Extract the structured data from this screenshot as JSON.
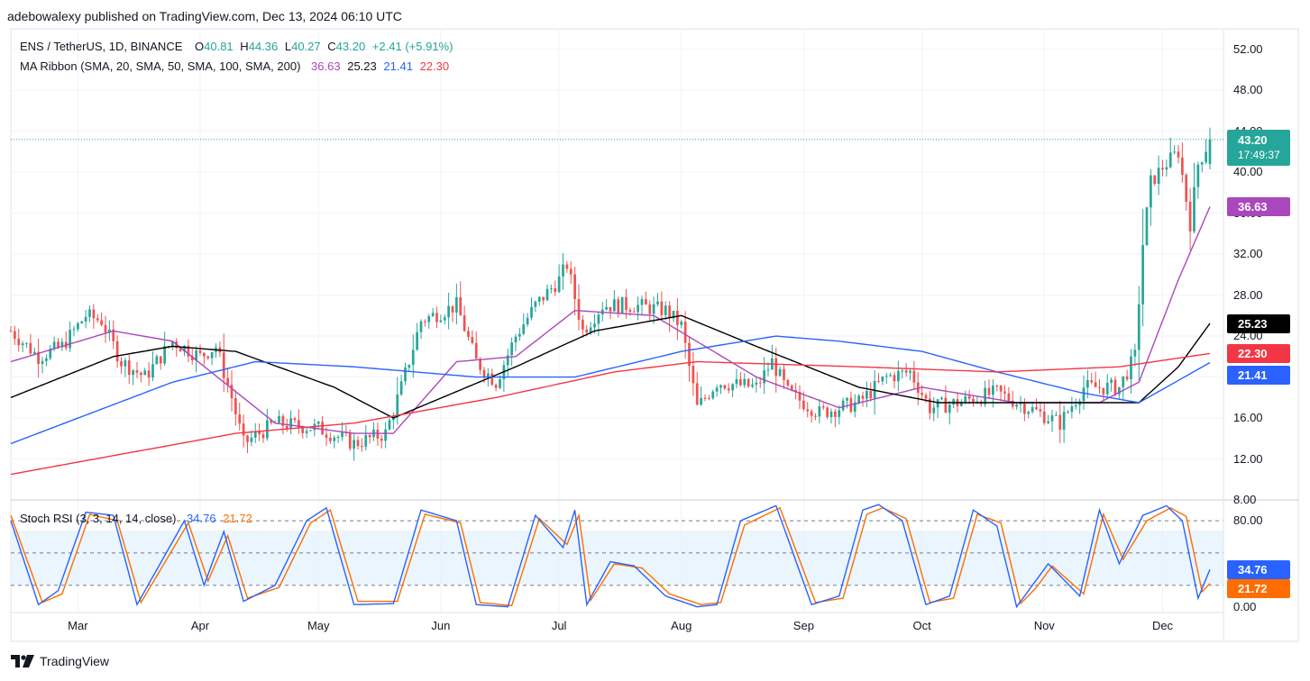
{
  "header": {
    "publish_line": "adebowalexy published on TradingView.com, Dec 13, 2024 06:10 UTC"
  },
  "footer": {
    "brand": "TradingView"
  },
  "legend": {
    "symbol": "ENS / TetherUS, 1D, BINANCE",
    "o_label": "O",
    "o_value": "40.81",
    "h_label": "H",
    "h_value": "44.36",
    "l_label": "L",
    "l_value": "40.27",
    "c_label": "C",
    "c_value": "43.20",
    "change": "+2.41 (+5.91%)",
    "ma_label": "MA Ribbon (SMA, 20, SMA, 50, SMA, 100, SMA, 200)",
    "ma_values": [
      "36.63",
      "25.23",
      "21.41",
      "22.30"
    ],
    "rsi_label": "Stoch RSI (3, 3, 14, 14, close)",
    "rsi_values": [
      "34.76",
      "21.72"
    ]
  },
  "price_tags": {
    "last": "43.20",
    "countdown": "17:49:37",
    "sma20": "36.63",
    "sma50": "25.23",
    "sma200": "22.30",
    "sma100": "21.41",
    "rsi_k": "34.76",
    "rsi_d": "21.72"
  },
  "colors": {
    "up": "#26a69a",
    "down": "#ef5350",
    "sma20": "#ab47bc",
    "sma50": "#000000",
    "sma100": "#2962ff",
    "sma200": "#f23645",
    "rsi_k": "#2962ff",
    "rsi_d": "#ff6d00",
    "rsi_band": "#e3f2fd"
  },
  "chart_data": [
    {
      "type": "candlestick",
      "title": "ENS / TetherUS, 1D, BINANCE",
      "y_ticks": [
        "52.00",
        "48.00",
        "44.00",
        "40.00",
        "36.00",
        "32.00",
        "28.00",
        "24.00",
        "20.00",
        "16.00",
        "12.00",
        "8.00"
      ],
      "x_ticks": [
        "Mar",
        "Apr",
        "May",
        "Jun",
        "Jul",
        "Aug",
        "Sep",
        "Oct",
        "Nov",
        "Dec"
      ],
      "ylim": [
        8,
        54
      ],
      "close_anchors": [
        [
          "Feb 13",
          24.5
        ],
        [
          "Feb 20",
          22.0
        ],
        [
          "Feb 26",
          23.0
        ],
        [
          "Mar 3",
          26.0
        ],
        [
          "Mar 7",
          25.5
        ],
        [
          "Mar 12",
          21.5
        ],
        [
          "Mar 18",
          20.0
        ],
        [
          "Mar 25",
          23.5
        ],
        [
          "Apr 1",
          22.0
        ],
        [
          "Apr 5",
          23.0
        ],
        [
          "Apr 9",
          18.0
        ],
        [
          "Apr 12",
          13.5
        ],
        [
          "Apr 20",
          15.5
        ],
        [
          "May 1",
          15.0
        ],
        [
          "May 10",
          13.5
        ],
        [
          "May 18",
          14.5
        ],
        [
          "May 22",
          19.0
        ],
        [
          "May 27",
          25.5
        ],
        [
          "Jun 5",
          27.0
        ],
        [
          "Jun 10",
          21.5
        ],
        [
          "Jun 15",
          19.5
        ],
        [
          "Jun 20",
          24.0
        ],
        [
          "Jun 25",
          27.0
        ],
        [
          "Jul 1",
          29.5
        ],
        [
          "Jul 3",
          31.0
        ],
        [
          "Jul 7",
          24.5
        ],
        [
          "Jul 12",
          27.0
        ],
        [
          "Jul 20",
          27.0
        ],
        [
          "Jul 28",
          26.5
        ],
        [
          "Aug 1",
          25.0
        ],
        [
          "Aug 5",
          17.0
        ],
        [
          "Aug 10",
          19.5
        ],
        [
          "Aug 20",
          19.0
        ],
        [
          "Aug 24",
          21.5
        ],
        [
          "Aug 28",
          18.5
        ],
        [
          "Sep 5",
          16.5
        ],
        [
          "Sep 15",
          17.5
        ],
        [
          "Sep 22",
          20.0
        ],
        [
          "Sep 28",
          20.5
        ],
        [
          "Oct 3",
          17.0
        ],
        [
          "Oct 10",
          17.5
        ],
        [
          "Oct 20",
          18.5
        ],
        [
          "Oct 28",
          17.0
        ],
        [
          "Nov 5",
          15.5
        ],
        [
          "Nov 11",
          19.0
        ],
        [
          "Nov 20",
          19.0
        ],
        [
          "Nov 24",
          22.0
        ],
        [
          "Nov 26",
          33.0
        ],
        [
          "Nov 28",
          39.0
        ],
        [
          "Dec 1",
          40.5
        ],
        [
          "Dec 5",
          42.0
        ],
        [
          "Dec 8",
          35.0
        ],
        [
          "Dec 10",
          40.8
        ],
        [
          "Dec 13",
          43.2
        ]
      ],
      "series": [
        {
          "name": "SMA 20",
          "last": 36.63,
          "anchors": [
            [
              "Feb 13",
              21.5
            ],
            [
              "Mar 10",
              24.5
            ],
            [
              "Mar 25",
              23.5
            ],
            [
              "Apr 20",
              15.5
            ],
            [
              "May 10",
              14.5
            ],
            [
              "May 20",
              14.5
            ],
            [
              "Jun 5",
              21.5
            ],
            [
              "Jun 20",
              22.0
            ],
            [
              "Jul 5",
              26.5
            ],
            [
              "Jul 25",
              26.0
            ],
            [
              "Aug 20",
              20.0
            ],
            [
              "Sep 10",
              17.0
            ],
            [
              "Oct 1",
              19.0
            ],
            [
              "Oct 25",
              17.5
            ],
            [
              "Nov 15",
              17.5
            ],
            [
              "Nov 25",
              19.5
            ],
            [
              "Dec 5",
              29.5
            ],
            [
              "Dec 13",
              36.63
            ]
          ]
        },
        {
          "name": "SMA 50",
          "last": 25.23,
          "anchors": [
            [
              "Feb 13",
              18.0
            ],
            [
              "Mar 10",
              22.0
            ],
            [
              "Mar 25",
              23.0
            ],
            [
              "Apr 10",
              22.5
            ],
            [
              "May 5",
              19.0
            ],
            [
              "May 20",
              16.0
            ],
            [
              "Jun 20",
              21.0
            ],
            [
              "Jul 10",
              24.5
            ],
            [
              "Aug 1",
              26.0
            ],
            [
              "Aug 20",
              23.0
            ],
            [
              "Sep 15",
              19.0
            ],
            [
              "Oct 5",
              17.5
            ],
            [
              "Nov 5",
              17.5
            ],
            [
              "Nov 25",
              17.5
            ],
            [
              "Dec 5",
              21.0
            ],
            [
              "Dec 13",
              25.23
            ]
          ]
        },
        {
          "name": "SMA 100",
          "last": 21.41,
          "anchors": [
            [
              "Feb 13",
              13.5
            ],
            [
              "Mar 25",
              19.5
            ],
            [
              "Apr 15",
              21.5
            ],
            [
              "May 10",
              21.0
            ],
            [
              "Jun 10",
              20.0
            ],
            [
              "Jul 5",
              20.0
            ],
            [
              "Aug 1",
              22.5
            ],
            [
              "Aug 25",
              24.0
            ],
            [
              "Sep 10",
              23.5
            ],
            [
              "Oct 1",
              22.5
            ],
            [
              "Oct 20",
              20.5
            ],
            [
              "Nov 10",
              18.5
            ],
            [
              "Nov 25",
              17.5
            ],
            [
              "Dec 13",
              21.41
            ]
          ]
        },
        {
          "name": "SMA 200",
          "last": 22.3,
          "anchors": [
            [
              "Feb 13",
              10.5
            ],
            [
              "Apr 10",
              14.5
            ],
            [
              "May 10",
              15.5
            ],
            [
              "Jun 15",
              18.0
            ],
            [
              "Jul 15",
              20.5
            ],
            [
              "Aug 5",
              21.5
            ],
            [
              "Sep 15",
              21.0
            ],
            [
              "Oct 20",
              20.5
            ],
            [
              "Nov 20",
              21.0
            ],
            [
              "Dec 13",
              22.3
            ]
          ]
        }
      ],
      "last_price": 43.2
    },
    {
      "type": "line",
      "title": "Stoch RSI (3, 3, 14, 14, close)",
      "y_ticks": [
        "80.00",
        "0.00"
      ],
      "ylim": [
        -2,
        96
      ],
      "bands": [
        20,
        50,
        80
      ],
      "series": [
        {
          "name": "K",
          "last": 34.76,
          "anchors": [
            [
              "Feb 13",
              80
            ],
            [
              "Feb 20",
              2
            ],
            [
              "Feb 25",
              15
            ],
            [
              "Mar 3",
              88
            ],
            [
              "Mar 10",
              85
            ],
            [
              "Mar 16",
              2
            ],
            [
              "Mar 28",
              80
            ],
            [
              "Apr 2",
              20
            ],
            [
              "Apr 7",
              70
            ],
            [
              "Apr 12",
              5
            ],
            [
              "Apr 20",
              20
            ],
            [
              "Apr 28",
              80
            ],
            [
              "May 3",
              92
            ],
            [
              "May 10",
              2
            ],
            [
              "May 20",
              3
            ],
            [
              "May 27",
              90
            ],
            [
              "Jun 5",
              80
            ],
            [
              "Jun 10",
              2
            ],
            [
              "Jun 18",
              0
            ],
            [
              "Jun 25",
              85
            ],
            [
              "Jul 2",
              55
            ],
            [
              "Jul 5",
              90
            ],
            [
              "Jul 8",
              2
            ],
            [
              "Jul 14",
              42
            ],
            [
              "Jul 20",
              38
            ],
            [
              "Jul 28",
              10
            ],
            [
              "Aug 5",
              0
            ],
            [
              "Aug 10",
              2
            ],
            [
              "Aug 16",
              80
            ],
            [
              "Aug 25",
              94
            ],
            [
              "Sep 3",
              2
            ],
            [
              "Sep 10",
              10
            ],
            [
              "Sep 16",
              90
            ],
            [
              "Sep 20",
              95
            ],
            [
              "Sep 26",
              80
            ],
            [
              "Oct 2",
              2
            ],
            [
              "Oct 8",
              10
            ],
            [
              "Oct 14",
              90
            ],
            [
              "Oct 20",
              75
            ],
            [
              "Oct 25",
              0
            ],
            [
              "Oct 29",
              20
            ],
            [
              "Nov 2",
              40
            ],
            [
              "Nov 10",
              10
            ],
            [
              "Nov 15",
              90
            ],
            [
              "Nov 20",
              40
            ],
            [
              "Nov 26",
              85
            ],
            [
              "Dec 2",
              94
            ],
            [
              "Dec 6",
              80
            ],
            [
              "Dec 10",
              8
            ],
            [
              "Dec 13",
              34.76
            ]
          ]
        },
        {
          "name": "D",
          "last": 21.72,
          "anchors": [
            [
              "Feb 13",
              85
            ],
            [
              "Feb 21",
              4
            ],
            [
              "Feb 26",
              12
            ],
            [
              "Mar 4",
              86
            ],
            [
              "Mar 11",
              80
            ],
            [
              "Mar 17",
              4
            ],
            [
              "Mar 29",
              78
            ],
            [
              "Apr 3",
              24
            ],
            [
              "Apr 8",
              66
            ],
            [
              "Apr 13",
              8
            ],
            [
              "Apr 21",
              18
            ],
            [
              "Apr 29",
              78
            ],
            [
              "May 4",
              90
            ],
            [
              "May 11",
              5
            ],
            [
              "May 21",
              5
            ],
            [
              "May 28",
              86
            ],
            [
              "Jun 6",
              78
            ],
            [
              "Jun 11",
              4
            ],
            [
              "Jun 19",
              1
            ],
            [
              "Jun 26",
              82
            ],
            [
              "Jul 3",
              58
            ],
            [
              "Jul 6",
              85
            ],
            [
              "Jul 9",
              6
            ],
            [
              "Jul 15",
              40
            ],
            [
              "Jul 22",
              36
            ],
            [
              "Jul 29",
              12
            ],
            [
              "Aug 6",
              2
            ],
            [
              "Aug 11",
              4
            ],
            [
              "Aug 17",
              76
            ],
            [
              "Aug 26",
              92
            ],
            [
              "Sep 4",
              4
            ],
            [
              "Sep 11",
              8
            ],
            [
              "Sep 17",
              86
            ],
            [
              "Sep 21",
              92
            ],
            [
              "Sep 27",
              82
            ],
            [
              "Oct 3",
              4
            ],
            [
              "Oct 9",
              8
            ],
            [
              "Oct 15",
              86
            ],
            [
              "Oct 21",
              78
            ],
            [
              "Oct 26",
              3
            ],
            [
              "Oct 30",
              18
            ],
            [
              "Nov 3",
              38
            ],
            [
              "Nov 11",
              12
            ],
            [
              "Nov 16",
              86
            ],
            [
              "Nov 21",
              44
            ],
            [
              "Nov 27",
              80
            ],
            [
              "Dec 3",
              92
            ],
            [
              "Dec 7",
              84
            ],
            [
              "Dec 11",
              14
            ],
            [
              "Dec 13",
              21.72
            ]
          ]
        }
      ]
    }
  ]
}
